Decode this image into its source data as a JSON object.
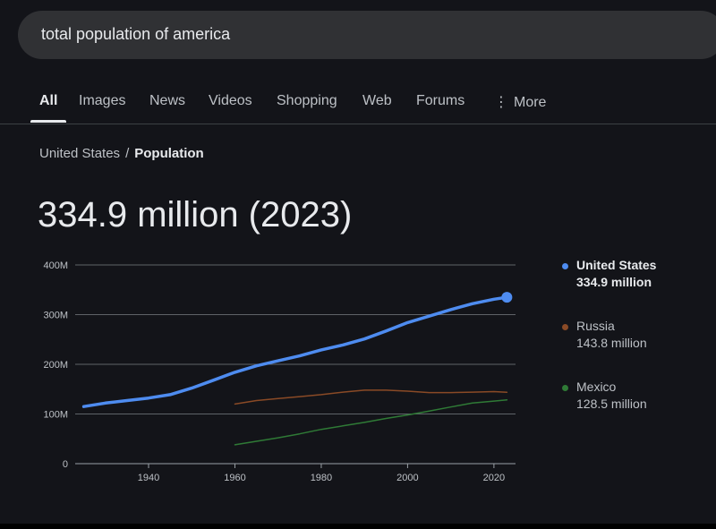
{
  "search": {
    "query": "total population of america"
  },
  "tabs": [
    {
      "label": "All",
      "active": true
    },
    {
      "label": "Images"
    },
    {
      "label": "News"
    },
    {
      "label": "Videos"
    },
    {
      "label": "Shopping"
    },
    {
      "label": "Web"
    },
    {
      "label": "Forums"
    },
    {
      "label": "More",
      "icon": "vertical-dots-icon"
    }
  ],
  "breadcrumb": {
    "parent": "United States",
    "separator": "/",
    "current": "Population"
  },
  "headline": "334.9 million (2023)",
  "colors": {
    "background": "#131419",
    "us": "#4e8cf0",
    "russia": "#8a4a26",
    "mexico": "#2f7a36",
    "grid": "#5f6368"
  },
  "chart_data": {
    "type": "line",
    "xlim": [
      1923,
      2025
    ],
    "ylim": [
      0,
      400
    ],
    "x_ticks": [
      1940,
      1960,
      1980,
      2000,
      2020
    ],
    "y_ticks": [
      0,
      100,
      200,
      300,
      400
    ],
    "y_tick_labels": [
      "0",
      "100M",
      "200M",
      "300M",
      "400M"
    ],
    "grid": "horizontal",
    "legend_position": "right",
    "series": [
      {
        "name": "United States",
        "value_label": "334.9 million",
        "color": "#4e8cf0",
        "highlight_last": true,
        "x": [
          1925,
          1930,
          1935,
          1940,
          1945,
          1950,
          1955,
          1960,
          1965,
          1970,
          1975,
          1980,
          1985,
          1990,
          1995,
          2000,
          2005,
          2010,
          2015,
          2020,
          2023
        ],
        "y": [
          115,
          122,
          127,
          132,
          139,
          152,
          168,
          184,
          197,
          207,
          217,
          229,
          239,
          251,
          267,
          284,
          297,
          310,
          322,
          331,
          334.9
        ]
      },
      {
        "name": "Russia",
        "value_label": "143.8 million",
        "color": "#8a4a26",
        "x": [
          1960,
          1965,
          1970,
          1975,
          1980,
          1985,
          1990,
          1995,
          2000,
          2005,
          2010,
          2015,
          2020,
          2023
        ],
        "y": [
          120,
          127,
          131,
          135,
          139,
          144,
          148,
          148,
          146,
          143,
          143,
          144,
          145,
          143.8
        ]
      },
      {
        "name": "Mexico",
        "value_label": "128.5 million",
        "color": "#2f7a36",
        "x": [
          1960,
          1965,
          1970,
          1975,
          1980,
          1985,
          1990,
          1995,
          2000,
          2005,
          2010,
          2015,
          2020,
          2023
        ],
        "y": [
          38,
          45,
          52,
          60,
          69,
          76,
          83,
          91,
          98,
          106,
          114,
          122,
          126,
          128.5
        ]
      }
    ]
  }
}
